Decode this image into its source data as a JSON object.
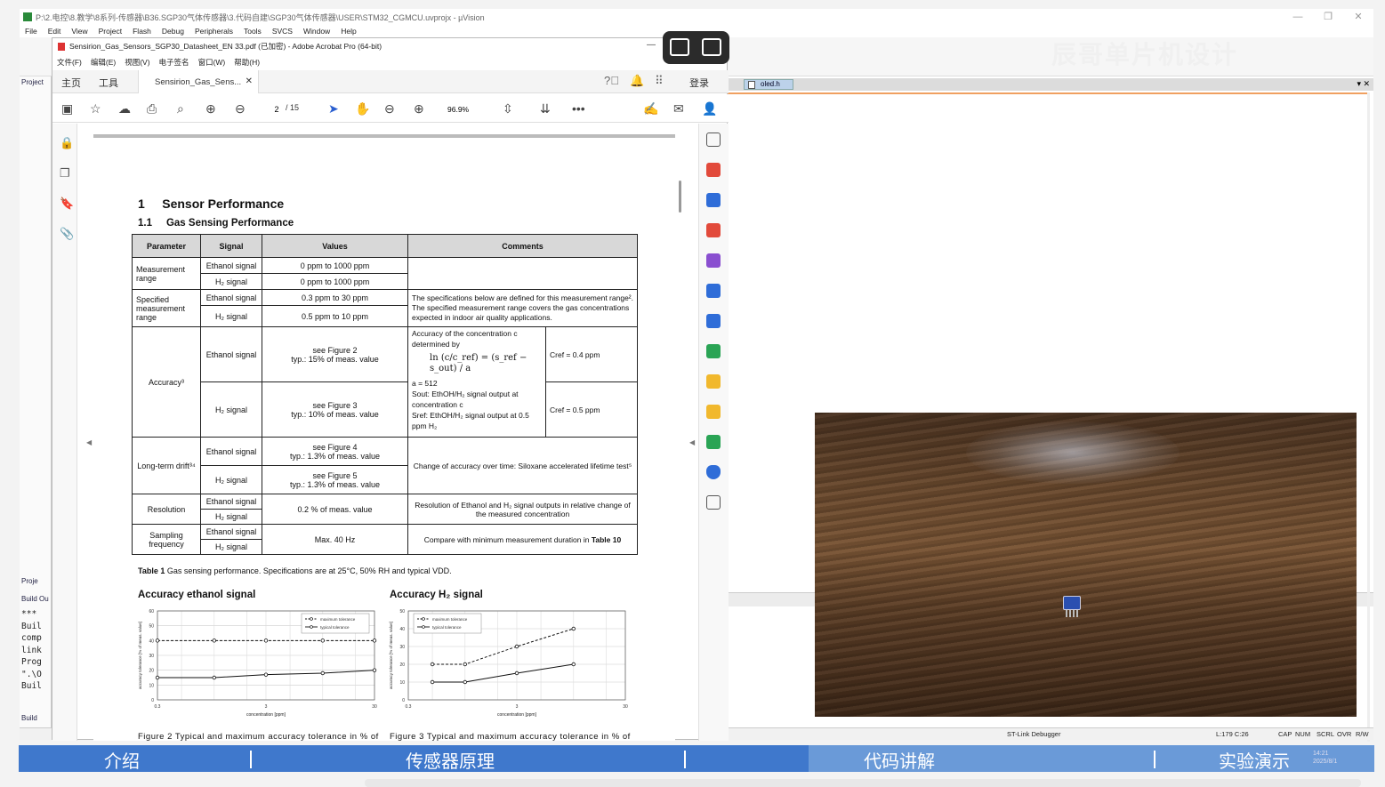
{
  "uvision": {
    "title": "P:\\2.电控\\8.教学\\8系列-传感器\\B36.SGP30气体传感器\\3.代码自建\\SGP30气体传感器\\USER\\STM32_CGMCU.uvprojx - µVision",
    "menu": [
      "File",
      "Edit",
      "View",
      "Project",
      "Flash",
      "Debug",
      "Peripherals",
      "Tools",
      "SVCS",
      "Window",
      "Help"
    ],
    "window_controls": [
      "—",
      "❐",
      "✕"
    ],
    "left_panel": {
      "project_tab": "Project",
      "proj_tab2": "Proje",
      "build_output_tab": "Build Ou",
      "build_tab2": "Build"
    },
    "build_output_lines": [
      "***",
      "Buil",
      "comp",
      "link",
      "Prog",
      "\".\\O",
      "Buil"
    ],
    "editor_tab": "oled.h",
    "status": {
      "debugger": "ST-Link Debugger",
      "position": "L:179 C:26",
      "caps": "CAP",
      "num": "NUM",
      "scrl": "SCRL",
      "ovr": "OVR",
      "rw": "R/W"
    },
    "watermark": "辰哥单片机设计"
  },
  "acrobat": {
    "title": "Sensirion_Gas_Sensors_SGP30_Datasheet_EN  33.pdf  (已加密)  - Adobe Acrobat Pro (64-bit)",
    "menu": [
      "文件(F)",
      "编辑(E)",
      "视图(V)",
      "电子签名",
      "窗口(W)",
      "帮助(H)"
    ],
    "tab_home": "主页",
    "tab_tools": "工具",
    "doc_tab": "Sensirion_Gas_Sens...",
    "login": "登录",
    "page_current": "2",
    "page_total": "/ 15",
    "zoom": "96.9%"
  },
  "doc": {
    "heading1": "1     Sensor Performance",
    "heading2": "1.1     Gas Sensing Performance",
    "table": {
      "headers": [
        "Parameter",
        "Signal",
        "Values",
        "Comments"
      ],
      "measurement_range": {
        "param": "Measurement range",
        "ethanol": "Ethanol signal",
        "ethanol_val": "0 ppm to 1000 ppm",
        "h2": "H₂ signal",
        "h2_val": "0 ppm to 1000 ppm"
      },
      "specified_range": {
        "param": "Specified measurement range",
        "ethanol": "Ethanol signal",
        "ethanol_val": "0.3 ppm to 30 ppm",
        "h2": "H₂ signal",
        "h2_val": "0.5 ppm to 10 ppm",
        "comment": "The specifications below are defined for this measurement range². The specified measurement range covers the gas concentrations expected in indoor air quality applications."
      },
      "accuracy": {
        "param": "Accuracy³",
        "ethanol": "Ethanol signal",
        "ethanol_val1": "see Figure 2",
        "ethanol_val2": "typ.: 15% of meas. value",
        "h2": "H₂ signal",
        "h2_val1": "see  Figure 3",
        "h2_val2": "typ.: 10% of meas. value",
        "comment_intro": "Accuracy of the concentration c determined by",
        "formula": "ln (c/c_ref) = (s_ref − s_out) / a",
        "a_val": "a = 512",
        "sout": "Sout: EthOH/H₂ signal output at concentration c",
        "sref": "Sref: EthOH/H₂ signal output at 0.5 ppm H₂",
        "cref_eth": "Cref = 0.4 ppm",
        "cref_h2": "Cref = 0.5 ppm"
      },
      "drift": {
        "param": "Long-term drift³⁴",
        "ethanol": "Ethanol signal",
        "ethanol_val1": "see Figure 4",
        "ethanol_val2": "typ.: 1.3% of meas. value",
        "h2": "H₂ signal",
        "h2_val1": "see Figure 5",
        "h2_val2": "typ.: 1.3% of meas. value",
        "comment": "Change of accuracy over time: Siloxane accelerated lifetime test⁵"
      },
      "resolution": {
        "param": "Resolution",
        "ethanol": "Ethanol signal",
        "h2": "H₂ signal",
        "val": "0.2 % of meas. value",
        "comment": "Resolution of Ethanol and H₂ signal outputs in relative change of the measured concentration"
      },
      "sampling": {
        "param": "Sampling frequency",
        "ethanol": "Ethanol signal",
        "h2": "H₂ signal",
        "val": "Max. 40 Hz",
        "comment_a": "Compare with minimum measurement duration in ",
        "comment_b": "Table 10"
      }
    },
    "caption_label": "Table 1",
    "caption_text": " Gas sensing performance. Specifications are at 25°C, 50% RH and typical VDD.",
    "fig2_caption": "Figure  2   Typical   and   maximum   accuracy   tolerance   in   %   of",
    "fig3_caption": "Figure  3   Typical   and   maximum   accuracy   tolerance   in   %   of"
  },
  "chart_data": [
    {
      "type": "line",
      "title": "Accuracy ethanol signal",
      "xlabel": "concentration [ppm]",
      "ylabel": "accuracy tolerance [% of meas. value]",
      "x_ticks": [
        "0.3",
        "3",
        "30"
      ],
      "y_ticks": [
        "0",
        "10",
        "20",
        "30",
        "40",
        "50",
        "60"
      ],
      "xlim": [
        0.3,
        30
      ],
      "ylim": [
        0,
        60
      ],
      "x_scale": "log",
      "grid": true,
      "legend": "top-right",
      "series": [
        {
          "name": "maximum tolerance",
          "style": "dashed",
          "x": [
            0.3,
            1,
            3,
            10,
            30
          ],
          "y": [
            40,
            40,
            40,
            40,
            40
          ]
        },
        {
          "name": "typical tolerance",
          "style": "solid",
          "x": [
            0.3,
            1,
            3,
            10,
            30
          ],
          "y": [
            15,
            15,
            17,
            18,
            20
          ]
        }
      ]
    },
    {
      "type": "line",
      "title": "Accuracy H₂ signal",
      "xlabel": "concentration [ppm]",
      "ylabel": "accuracy tolerance [% of meas. value]",
      "x_ticks": [
        "0.3",
        "3",
        "30"
      ],
      "y_ticks": [
        "0",
        "10",
        "20",
        "30",
        "40",
        "50"
      ],
      "xlim": [
        0.3,
        30
      ],
      "ylim": [
        0,
        50
      ],
      "x_scale": "log",
      "grid": true,
      "legend": "top-left",
      "series": [
        {
          "name": "maximum tolerance",
          "style": "dashed",
          "x": [
            0.5,
            1,
            3,
            10
          ],
          "y": [
            20,
            20,
            30,
            40
          ]
        },
        {
          "name": "typical tolerance",
          "style": "solid",
          "x": [
            0.5,
            1,
            3,
            10
          ],
          "y": [
            10,
            10,
            15,
            20
          ]
        }
      ]
    }
  ],
  "chapters": {
    "items": [
      "介绍",
      "传感器原理",
      "代码讲解",
      "实验演示"
    ],
    "progress": 0.583
  },
  "taskbar": {
    "time": "14:21",
    "date": "2025/8/1"
  }
}
